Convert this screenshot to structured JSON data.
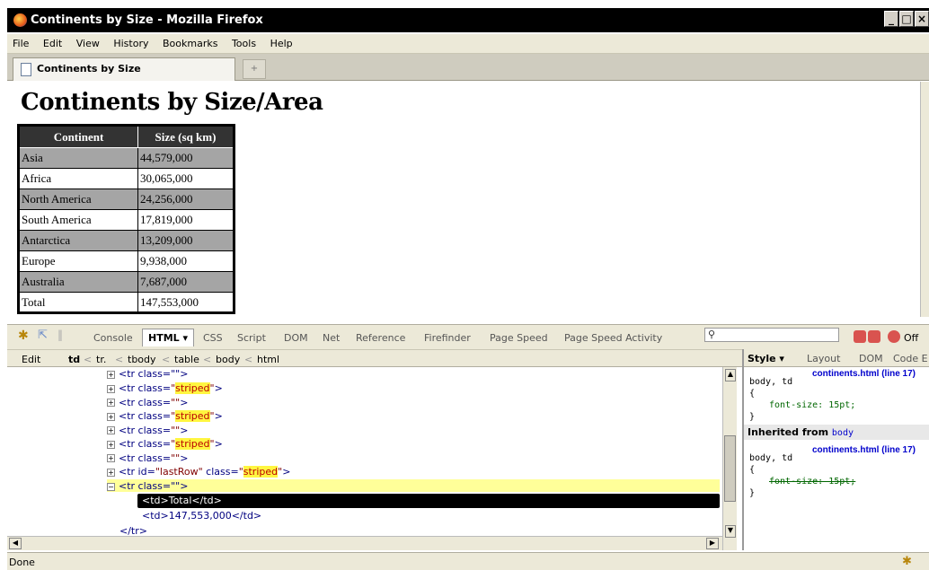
{
  "window": {
    "title": "Continents by Size - Mozilla Firefox"
  },
  "menu": [
    "File",
    "Edit",
    "View",
    "History",
    "Bookmarks",
    "Tools",
    "Help"
  ],
  "tab": {
    "label": "Continents by Size",
    "new_tab": "+"
  },
  "page": {
    "heading": "Continents by Size/Area",
    "table": {
      "headers": [
        "Continent",
        "Size (sq km)"
      ],
      "rows": [
        [
          "Asia",
          "44,579,000"
        ],
        [
          "Africa",
          "30,065,000"
        ],
        [
          "North America",
          "24,256,000"
        ],
        [
          "South America",
          "17,819,000"
        ],
        [
          "Antarctica",
          "13,209,000"
        ],
        [
          "Europe",
          "9,938,000"
        ],
        [
          "Australia",
          "7,687,000"
        ],
        [
          "Total",
          "147,553,000"
        ]
      ]
    }
  },
  "firebug": {
    "tabs": [
      "Console",
      "HTML ▾",
      "CSS",
      "Script",
      "DOM",
      "Net",
      "Reference",
      "Firefinder",
      "Page Speed",
      "Page Speed Activity"
    ],
    "off_label": "Off",
    "breadcrumb": {
      "edit": "Edit",
      "items": [
        "td",
        "tr.",
        "tbody",
        "table",
        "body",
        "html"
      ]
    },
    "tree": [
      {
        "text": "<tr class=\"\">",
        "indent": 0
      },
      {
        "tag": "tr",
        "attrs": [
          [
            "class",
            "striped"
          ]
        ],
        "hl": true
      },
      {
        "tag": "tr",
        "attrs": [
          [
            "class",
            ""
          ]
        ]
      },
      {
        "tag": "tr",
        "attrs": [
          [
            "class",
            "striped"
          ]
        ],
        "hl": true
      },
      {
        "tag": "tr",
        "attrs": [
          [
            "class",
            ""
          ]
        ]
      },
      {
        "tag": "tr",
        "attrs": [
          [
            "class",
            "striped"
          ]
        ],
        "hl": true
      },
      {
        "tag": "tr",
        "attrs": [
          [
            "class",
            ""
          ]
        ]
      },
      {
        "tag": "tr",
        "attrs": [
          [
            "id",
            "lastRow"
          ],
          [
            "class",
            "striped"
          ]
        ],
        "hl": true
      }
    ],
    "open_row": "<tr class=\"\">",
    "selected_td": "<td>Total</td>",
    "next_td": "<td>147,553,000</td>",
    "close_tr": "</tr>",
    "side": {
      "tabs": [
        "Style ▾",
        "Layout",
        "DOM",
        "Code E"
      ],
      "rule1": {
        "selector": "body, td",
        "source": "continents.html (line 17)",
        "prop": "font-size: 15pt;"
      },
      "inherited": {
        "label": "Inherited from",
        "el": "body"
      },
      "rule2": {
        "selector": "body, td",
        "source": "continents.html (line 17)",
        "prop": "font-size: 15pt;"
      }
    }
  },
  "status": {
    "text": "Done"
  }
}
